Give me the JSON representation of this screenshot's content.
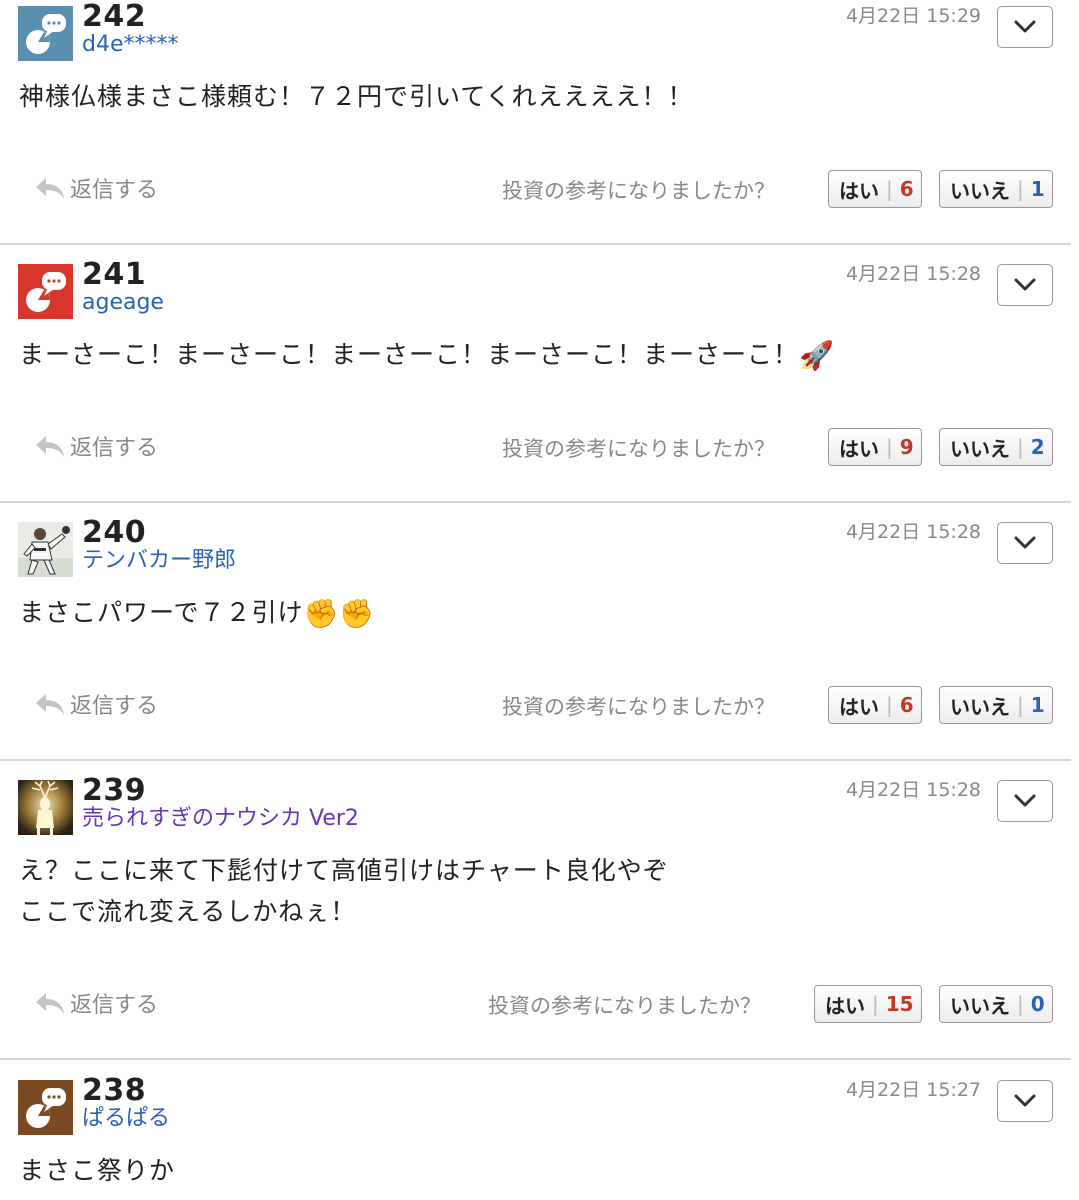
{
  "posts": [
    {
      "number": "242",
      "user": "d4e*****",
      "time": "4月22日 15:29",
      "text": "神様仏様まさこ様頼む！７２円で引いてくれええええ！！",
      "reply_label": "返信する",
      "question": "投資の参考になりましたか？",
      "yes_label": "はい",
      "yes_count": "6",
      "no_label": "いいえ",
      "no_count": "1",
      "avatar_color": "#5b8fb0"
    },
    {
      "number": "241",
      "user": "ageage",
      "time": "4月22日 15:28",
      "text": "まーさーこ！まーさーこ！まーさーこ！まーさーこ！まーさーこ！",
      "emoji": "🚀",
      "reply_label": "返信する",
      "question": "投資の参考になりましたか？",
      "yes_label": "はい",
      "yes_count": "9",
      "no_label": "いいえ",
      "no_count": "2",
      "avatar_color": "#d8362c"
    },
    {
      "number": "240",
      "user": "テンバカー野郎",
      "time": "4月22日 15:28",
      "text": "まさこパワーで７２引け",
      "emoji": "✊✊",
      "reply_label": "返信する",
      "question": "投資の参考になりましたか？",
      "yes_label": "はい",
      "yes_count": "6",
      "no_label": "いいえ",
      "no_count": "1"
    },
    {
      "number": "239",
      "user": "売られすぎのナウシカ Ver2",
      "time": "4月22日 15:28",
      "text": "え？ここに来て下髭付けて高値引けはチャート良化やぞ\nここで流れ変えるしかねぇ！",
      "reply_label": "返信する",
      "question": "投資の参考になりましたか？",
      "yes_label": "はい",
      "yes_count": "15",
      "no_label": "いいえ",
      "no_count": "0"
    },
    {
      "number": "238",
      "user": "ぱるぱる",
      "time": "4月22日 15:27",
      "text": "まさこ祭りか",
      "avatar_color": "#7a4a22"
    }
  ],
  "icons": {
    "menu": "chevron-down-icon",
    "reply": "reply-arrow-icon",
    "avatar_default": "speech-bubble-avatar-icon"
  },
  "colors": {
    "username": "#2a62b8",
    "username_alt": "#6a34b8",
    "yes_count": "#c0392b",
    "no_count": "#2a62b8",
    "divider": "#d6d6d6"
  }
}
